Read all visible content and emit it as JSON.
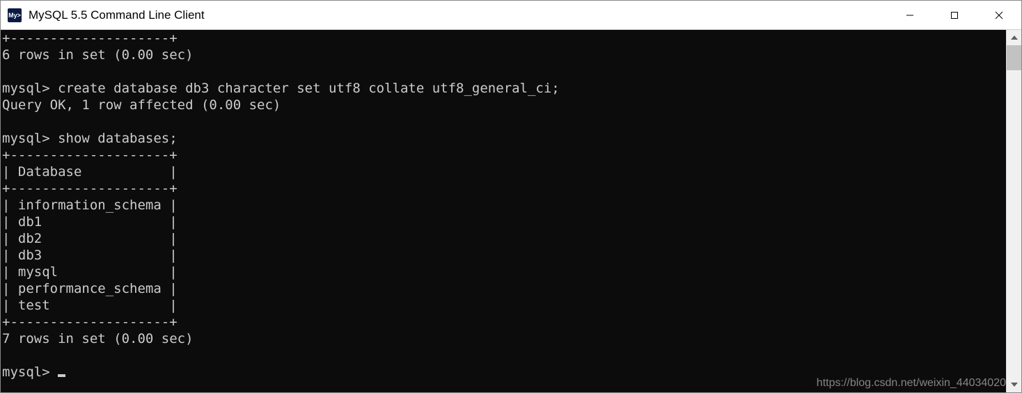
{
  "window": {
    "title": "MySQL 5.5 Command Line Client",
    "icon_label": "mysql-icon"
  },
  "terminal": {
    "lines": [
      "+--------------------+",
      "6 rows in set (0.00 sec)",
      "",
      "mysql> create database db3 character set utf8 collate utf8_general_ci;",
      "Query OK, 1 row affected (0.00 sec)",
      "",
      "mysql> show databases;",
      "+--------------------+",
      "| Database           |",
      "+--------------------+",
      "| information_schema |",
      "| db1                |",
      "| db2                |",
      "| db3                |",
      "| mysql              |",
      "| performance_schema |",
      "| test               |",
      "+--------------------+",
      "7 rows in set (0.00 sec)",
      "",
      "mysql> "
    ],
    "prompt_cursor": true
  },
  "watermark": "https://blog.csdn.net/weixin_44034020"
}
